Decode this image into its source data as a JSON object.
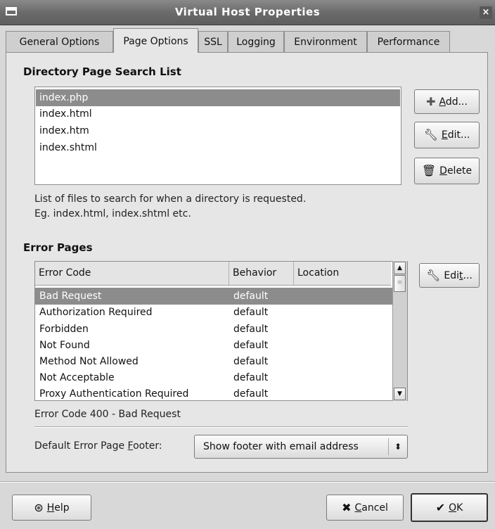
{
  "window": {
    "title": "Virtual Host Properties",
    "close_glyph": "×"
  },
  "tabs": [
    {
      "label": "General Options"
    },
    {
      "label": "Page Options"
    },
    {
      "label": "SSL"
    },
    {
      "label": "Logging"
    },
    {
      "label": "Environment"
    },
    {
      "label": "Performance"
    }
  ],
  "dir_section": {
    "title": "Directory Page Search List",
    "items": [
      "index.php",
      "index.html",
      "index.htm",
      "index.shtml"
    ],
    "selected_index": 0,
    "help_line1": "List of files to search for when a directory is requested.",
    "help_line2": "Eg. index.html, index.shtml etc.",
    "add_label_u": "A",
    "add_label_rest": "dd...",
    "edit_label_u": "E",
    "edit_label_rest": "dit...",
    "delete_label_u": "D",
    "delete_label_rest": "elete"
  },
  "error_section": {
    "title": "Error Pages",
    "columns": [
      "Error Code",
      "Behavior",
      "Location"
    ],
    "rows": [
      {
        "code": "Bad Request",
        "behavior": "default",
        "location": ""
      },
      {
        "code": "Authorization Required",
        "behavior": "default",
        "location": ""
      },
      {
        "code": "Forbidden",
        "behavior": "default",
        "location": ""
      },
      {
        "code": "Not Found",
        "behavior": "default",
        "location": ""
      },
      {
        "code": "Method Not Allowed",
        "behavior": "default",
        "location": ""
      },
      {
        "code": "Not Acceptable",
        "behavior": "default",
        "location": ""
      },
      {
        "code": "Proxy Authentication Required",
        "behavior": "default",
        "location": ""
      }
    ],
    "selected_index": 0,
    "edit_label_pre": "Edi",
    "edit_label_u": "t",
    "edit_label_rest": "...",
    "status": "Error Code 400 - Bad Request",
    "footer_label_pre": "Default Error Page ",
    "footer_label_u": "F",
    "footer_label_rest": "ooter:",
    "footer_value": "Show footer with email address"
  },
  "buttons": {
    "help_u": "H",
    "help_rest": "elp",
    "cancel_u": "C",
    "cancel_rest": "ancel",
    "ok_u": "O",
    "ok_rest": "K"
  }
}
